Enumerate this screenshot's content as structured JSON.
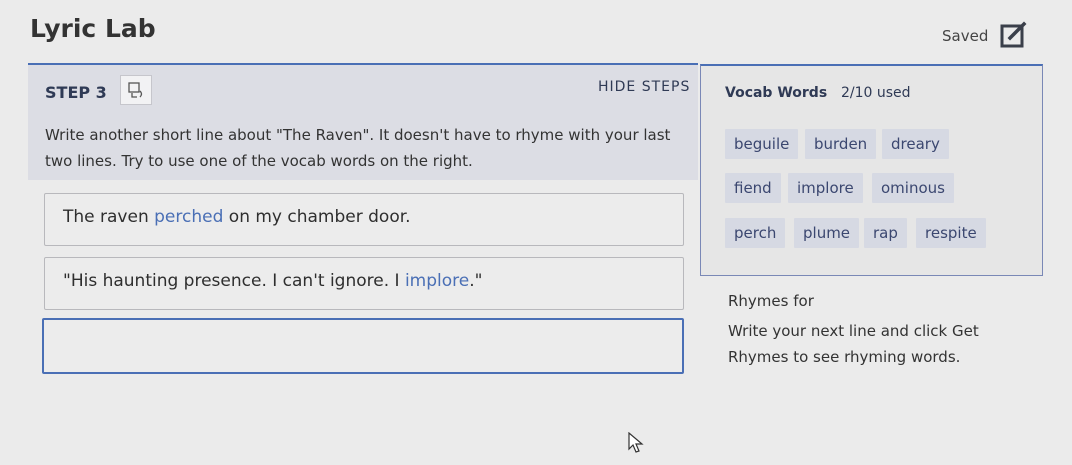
{
  "app": {
    "title": "Lyric Lab",
    "saved_label": "Saved"
  },
  "step": {
    "label": "STEP 3",
    "hide_label": "HIDE STEPS",
    "instruction_line1": "Write another short line about \"The Raven\". It doesn't have to rhyme with your last",
    "instruction_line2": "two lines. Try to use one of the vocab words on the right."
  },
  "lines": [
    {
      "before": "The raven ",
      "vocab": "perched",
      "after": " on my chamber door."
    },
    {
      "before": "\"His haunting presence. I can't ignore. I ",
      "vocab": "implore",
      "after": ".\""
    }
  ],
  "new_line": {
    "value": "",
    "placeholder": ""
  },
  "vocab": {
    "header": "Vocab Words",
    "used": "2/10 used",
    "words": [
      "beguile",
      "burden",
      "dreary",
      "fiend",
      "implore",
      "ominous",
      "perch",
      "plume",
      "rap",
      "respite"
    ]
  },
  "rhymes": {
    "title": "Rhymes for",
    "description": "Write your next line and click Get Rhymes to see rhyming words."
  },
  "colors": {
    "accent": "#4a6fb5",
    "chip_bg": "#d6d9e3"
  }
}
